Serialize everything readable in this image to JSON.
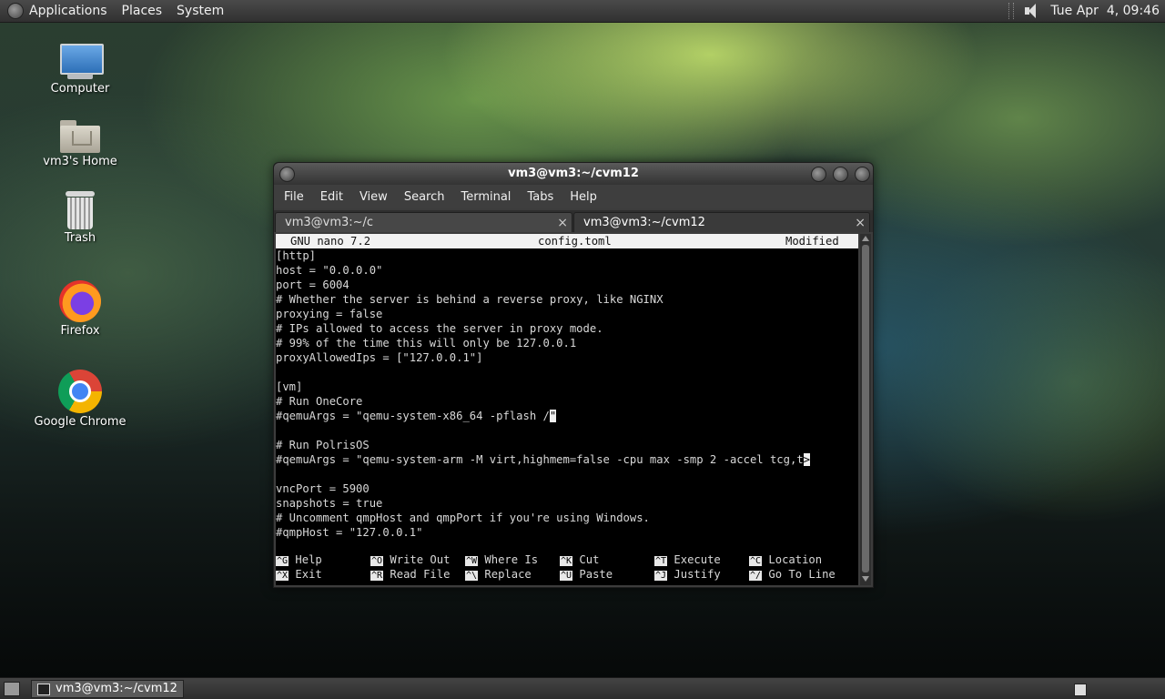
{
  "top_panel": {
    "menus": [
      "Applications",
      "Places",
      "System"
    ],
    "clock": "Tue Apr  4, 09:46"
  },
  "desktop": {
    "icons": [
      {
        "label": "Computer",
        "icon": "computer-icon"
      },
      {
        "label": "vm3's Home",
        "icon": "home-folder-icon"
      },
      {
        "label": "Trash",
        "icon": "trash-icon"
      },
      {
        "label": "Firefox",
        "icon": "firefox-icon"
      },
      {
        "label": "Google Chrome",
        "icon": "chrome-icon"
      }
    ]
  },
  "window": {
    "title": "vm3@vm3:~/cvm12",
    "menus": [
      "File",
      "Edit",
      "View",
      "Search",
      "Terminal",
      "Tabs",
      "Help"
    ],
    "tabs": [
      {
        "label": "vm3@vm3:~/c",
        "close": "×"
      },
      {
        "label": "vm3@vm3:~/cvm12",
        "close": "×"
      }
    ]
  },
  "nano": {
    "version": "GNU nano 7.2",
    "filename": "config.toml",
    "status": "Modified",
    "lines": [
      "[http]",
      "host = \"0.0.0.0\"",
      "port = 6004",
      "# Whether the server is behind a reverse proxy, like NGINX",
      "proxying = false",
      "# IPs allowed to access the server in proxy mode.",
      "# 99% of the time this will only be 127.0.0.1",
      "proxyAllowedIps = [\"127.0.0.1\"]",
      "",
      "[vm]",
      "# Run OneCore",
      "#qemuArgs = \"qemu-system-x86_64 -pflash /",
      "",
      "# Run PolrisOS",
      "#qemuArgs = \"qemu-system-arm -M virt,highmem=false -cpu max -smp 2 -accel tcg,t",
      "",
      "vncPort = 5900",
      "snapshots = true",
      "# Uncomment qmpHost and qmpPort if you're using Windows.",
      "#qmpHost = \"127.0.0.1\""
    ],
    "cursor_char": "\"",
    "overflow_char": ">",
    "shortcuts_row1": [
      {
        "key": "^G",
        "label": "Help"
      },
      {
        "key": "^O",
        "label": "Write Out"
      },
      {
        "key": "^W",
        "label": "Where Is"
      },
      {
        "key": "^K",
        "label": "Cut"
      },
      {
        "key": "^T",
        "label": "Execute"
      },
      {
        "key": "^C",
        "label": "Location"
      }
    ],
    "shortcuts_row2": [
      {
        "key": "^X",
        "label": "Exit"
      },
      {
        "key": "^R",
        "label": "Read File"
      },
      {
        "key": "^\\",
        "label": "Replace"
      },
      {
        "key": "^U",
        "label": "Paste"
      },
      {
        "key": "^J",
        "label": "Justify"
      },
      {
        "key": "^/",
        "label": "Go To Line"
      }
    ]
  },
  "taskbar": {
    "task_label": "vm3@vm3:~/cvm12"
  }
}
